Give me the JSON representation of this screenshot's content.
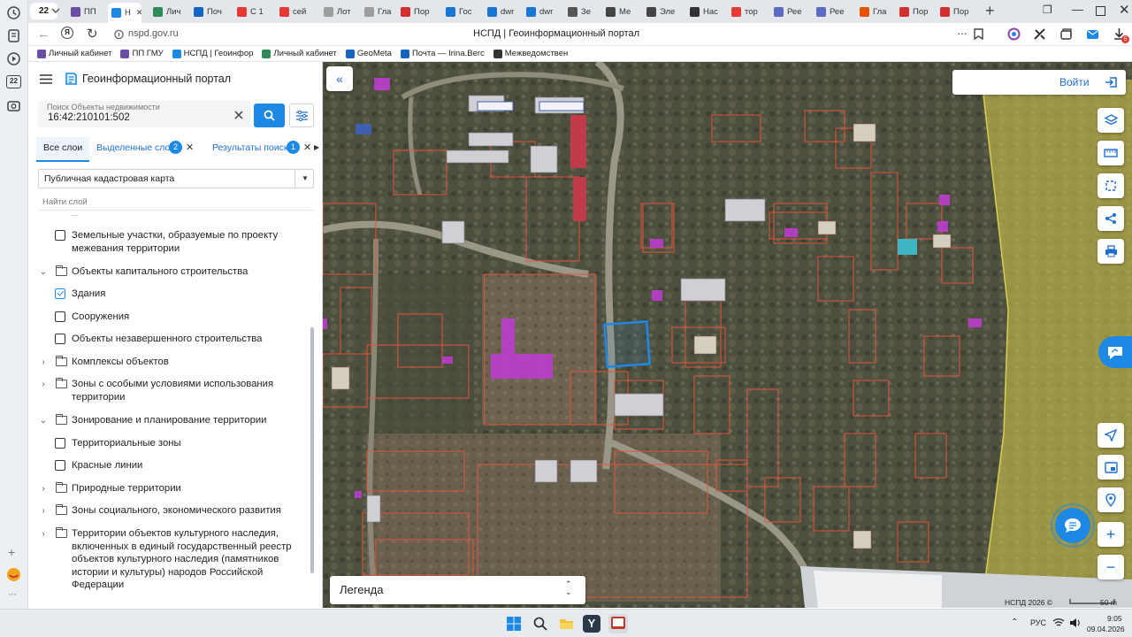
{
  "browser": {
    "tab_count": "22",
    "tabs": [
      {
        "label": "ПП",
        "color": "#6a4fa3"
      },
      {
        "label": "Н",
        "color": "#1e88e5",
        "active": true
      },
      {
        "label": "Лич",
        "color": "#2e8b57"
      },
      {
        "label": "Поч",
        "color": "#1565c0"
      },
      {
        "label": "С 1",
        "color": "#e53935"
      },
      {
        "label": "сей",
        "color": "#e53935"
      },
      {
        "label": "Лот",
        "color": "#9e9e9e"
      },
      {
        "label": "Гла",
        "color": "#9e9e9e"
      },
      {
        "label": "Пор",
        "color": "#d32f2f"
      },
      {
        "label": "Гос",
        "color": "#1976d2"
      },
      {
        "label": "dwr",
        "color": "#1976d2"
      },
      {
        "label": "dwr",
        "color": "#1976d2"
      },
      {
        "label": "Зе",
        "color": "#555555"
      },
      {
        "label": "Ме",
        "color": "#444444"
      },
      {
        "label": "Эле",
        "color": "#444444"
      },
      {
        "label": "Нас",
        "color": "#333333"
      },
      {
        "label": "тор",
        "color": "#e53935"
      },
      {
        "label": "Рее",
        "color": "#5c6bc0"
      },
      {
        "label": "Рее",
        "color": "#5c6bc0"
      },
      {
        "label": "Гла",
        "color": "#e65100"
      },
      {
        "label": "Пор",
        "color": "#d32f2f"
      },
      {
        "label": "Пор",
        "color": "#d32f2f"
      }
    ],
    "new_tab": "+",
    "url": "nspd.gov.ru",
    "page_title": "НСПД | Геоинформационный портал",
    "bookmarks": [
      {
        "label": "Личный кабинет",
        "color": "#6a4fa3"
      },
      {
        "label": "ПП ГМУ",
        "color": "#6a4fa3"
      },
      {
        "label": "НСПД | Геоинфор",
        "color": "#1e88e5"
      },
      {
        "label": "Личный кабинет",
        "color": "#2e8b57"
      },
      {
        "label": "GeoMeta",
        "color": "#1565c0"
      },
      {
        "label": "Почта — Irina.Berc",
        "color": "#1565c0"
      },
      {
        "label": "Межведомствен",
        "color": "#333333"
      }
    ],
    "download_badge": "5"
  },
  "portal": {
    "title": "Геоинформационный портал",
    "search_label": "Поиск Объекты недвижимости",
    "search_value": "16:42:210101:502",
    "tabs": {
      "all": "Все слои",
      "selected": "Выделенные слои",
      "selected_count": "2",
      "results": "Результаты поиска",
      "results_count": "1"
    },
    "map_select": "Публичная кадастровая карта",
    "find_layer": "Найти слой",
    "truncated_top": "...",
    "layers": [
      {
        "kind": "checkbox",
        "checked": false,
        "label": "Земельные участки, образуемые по проекту межевания территории"
      },
      {
        "kind": "folder",
        "expanded": true,
        "label": "Объекты капитального строительства"
      },
      {
        "kind": "checkbox",
        "checked": true,
        "label": "Здания"
      },
      {
        "kind": "checkbox",
        "checked": false,
        "label": "Сооружения"
      },
      {
        "kind": "checkbox",
        "checked": false,
        "label": "Объекты незавершенного строительства"
      },
      {
        "kind": "folder",
        "expanded": false,
        "label": "Комплексы объектов"
      },
      {
        "kind": "folder",
        "expanded": false,
        "label": "Зоны с особыми условиями использования территории"
      },
      {
        "kind": "folder",
        "expanded": true,
        "label": "Зонирование и планирование территории"
      },
      {
        "kind": "checkbox",
        "checked": false,
        "label": "Территориальные зоны"
      },
      {
        "kind": "checkbox",
        "checked": false,
        "label": "Красные линии"
      },
      {
        "kind": "folder",
        "expanded": false,
        "label": "Природные территории"
      },
      {
        "kind": "folder",
        "expanded": false,
        "label": "Зоны социального, экономического развития"
      },
      {
        "kind": "folder",
        "expanded": false,
        "label": "Территории объектов культурного наследия, включенных в единый государственный реестр объектов культурного наследия (памятников истории и культуры) народов Российской Федерации"
      }
    ]
  },
  "map": {
    "login": "Войти",
    "legend": "Легенда",
    "copyright": "НСПД 2026 ©",
    "scale": "50 m",
    "colors": {
      "accent": "#1e6fd0",
      "parcel": "#e2553a",
      "building": "#c23bd6",
      "selected": "#1e88e5",
      "zone": "#d9cf55"
    }
  },
  "taskbar": {
    "lang": "РУС",
    "time": "9:05",
    "date": "09.04.2026"
  }
}
